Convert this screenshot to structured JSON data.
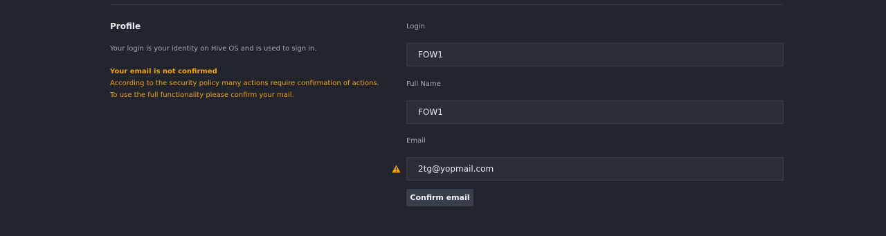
{
  "profile": {
    "title": "Profile",
    "login_description": "Your login is your identity on Hive OS and is used to sign in.",
    "warning": {
      "title": "Your email is not confirmed",
      "line1": "According to the security policy many actions require confirmation of actions.",
      "line2": "To use the full functionality please confirm your mail.",
      "icon": "warning-triangle-icon",
      "color": "#f0a00e"
    }
  },
  "form": {
    "login": {
      "label": "Login",
      "value": "FOW1"
    },
    "full_name": {
      "label": "Full Name",
      "value": "FOW1"
    },
    "email": {
      "label": "Email",
      "value": "2tg@yopmail.com"
    },
    "confirm_button": "Confirm email"
  }
}
